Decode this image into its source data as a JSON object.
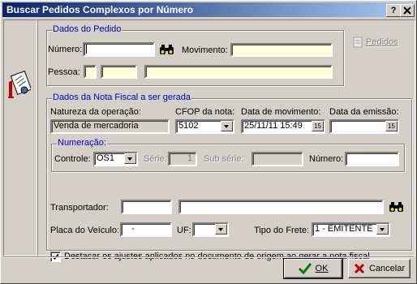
{
  "window": {
    "title": "Buscar Pedidos Complexos por Número",
    "help_btn": "?",
    "close_btn": "X"
  },
  "dados_pedido": {
    "legend": "Dados do Pedido",
    "numero_label": "Número:",
    "numero_value": "",
    "movimento_label": "Movimento:",
    "movimento_value": "",
    "pessoa_label": "Pessoa:",
    "pedidos_btn": "Pedidos"
  },
  "nota_fiscal": {
    "legend": "Dados da Nota Fiscal a ser gerada",
    "natureza_label": "Natureza da operação:",
    "natureza_value": "Venda de mercadoria",
    "cfop_label": "CFOP da nota:",
    "cfop_value": "5102",
    "data_mov_label": "Data de movimento:",
    "data_mov_value": "25/11/11 15:49",
    "data_emissao_label": "Data da emissão:",
    "data_emissao_value": "",
    "numeracao": {
      "legend": "Numeração:",
      "controle_label": "Controle:",
      "controle_value": "OS1",
      "serie_label": "Série:",
      "serie_value": "1",
      "subserie_label": "Sub série:",
      "numero_label": "Número:"
    },
    "transportador_label": "Transportador:",
    "placa_label": "Placa do Veículo:",
    "placa_value": "-",
    "uf_label": "UF:",
    "frete_label": "Tipo do Frete:",
    "frete_value": "1 - EMITENTE",
    "destacar_label": "Destacar os ajustes aplicados no documento de origem ao gerar a nota fiscal",
    "destacar_checked": true
  },
  "footer": {
    "ok_label": "OK",
    "cancel_label": "Cancelar"
  },
  "colors": {
    "title_start": "#0a246a",
    "title_end": "#a6caf0",
    "legend": "#0000c0",
    "yellow_field": "#ffffd8",
    "face": "#d4d0c8"
  }
}
